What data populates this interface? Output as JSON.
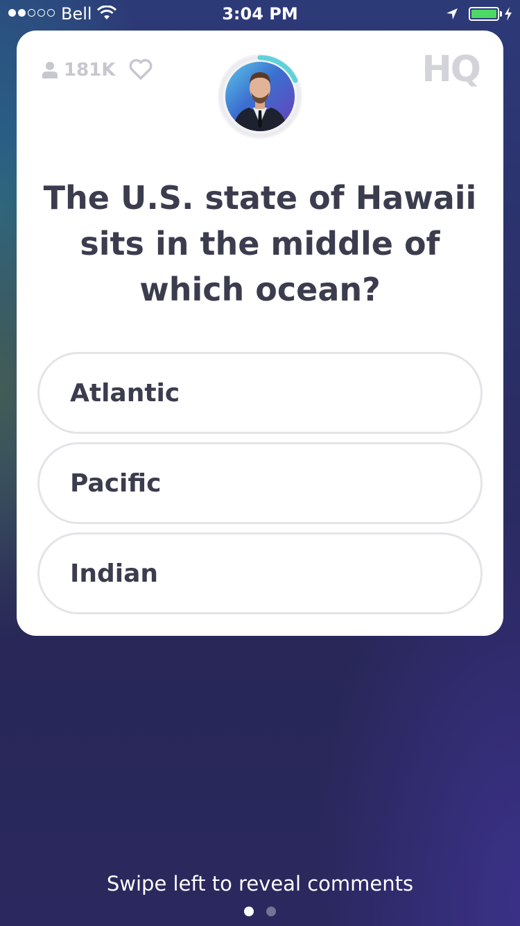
{
  "status_bar": {
    "carrier": "Bell",
    "time": "3:04 PM",
    "signal_strength": 2,
    "signal_max": 5,
    "battery_color": "#4cd964"
  },
  "header": {
    "viewer_count": "181K",
    "viewer_icon": "person-icon",
    "heart_icon": "heart-icon",
    "logo_text": "HQ"
  },
  "question": {
    "text": "The U.S. state of Hawaii sits in the middle of which ocean?"
  },
  "answers": [
    {
      "label": "Atlantic"
    },
    {
      "label": "Pacific"
    },
    {
      "label": "Indian"
    }
  ],
  "footer": {
    "hint": "Swipe left to reveal comments",
    "page_count": 2,
    "active_page": 1
  },
  "colors": {
    "card_bg": "#ffffff",
    "text_dark": "#3b3c4e",
    "muted": "#c7c7d0",
    "timer_ring": "#5ed2d8"
  }
}
